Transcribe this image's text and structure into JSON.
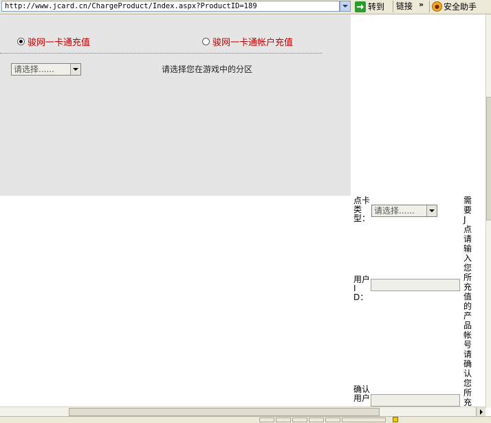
{
  "address_bar": {
    "url": "http://www.jcard.cn/ChargeProduct/Index.aspx?ProductID=189",
    "go_label": "转到",
    "links_label": "链接",
    "more_label": "»",
    "security_label": "安全助手"
  },
  "recharge": {
    "option_card": "骏网一卡通充值",
    "option_account": "骏网一卡通帐户充值",
    "selected": "option_card"
  },
  "zone": {
    "select_value": "请选择......",
    "hint": "请选择您在游戏中的分区"
  },
  "form": {
    "card_type_label": "点卡类型：",
    "card_type_value": "请选择......",
    "user_id_label": "用户ID：",
    "confirm_user_label": "确认用户",
    "side_hint": "需要J点请输入您所充值的产品帐号请确认您所充值"
  },
  "colors": {
    "radio_label": "#c00000",
    "panel_bg": "#e5e5e5"
  }
}
